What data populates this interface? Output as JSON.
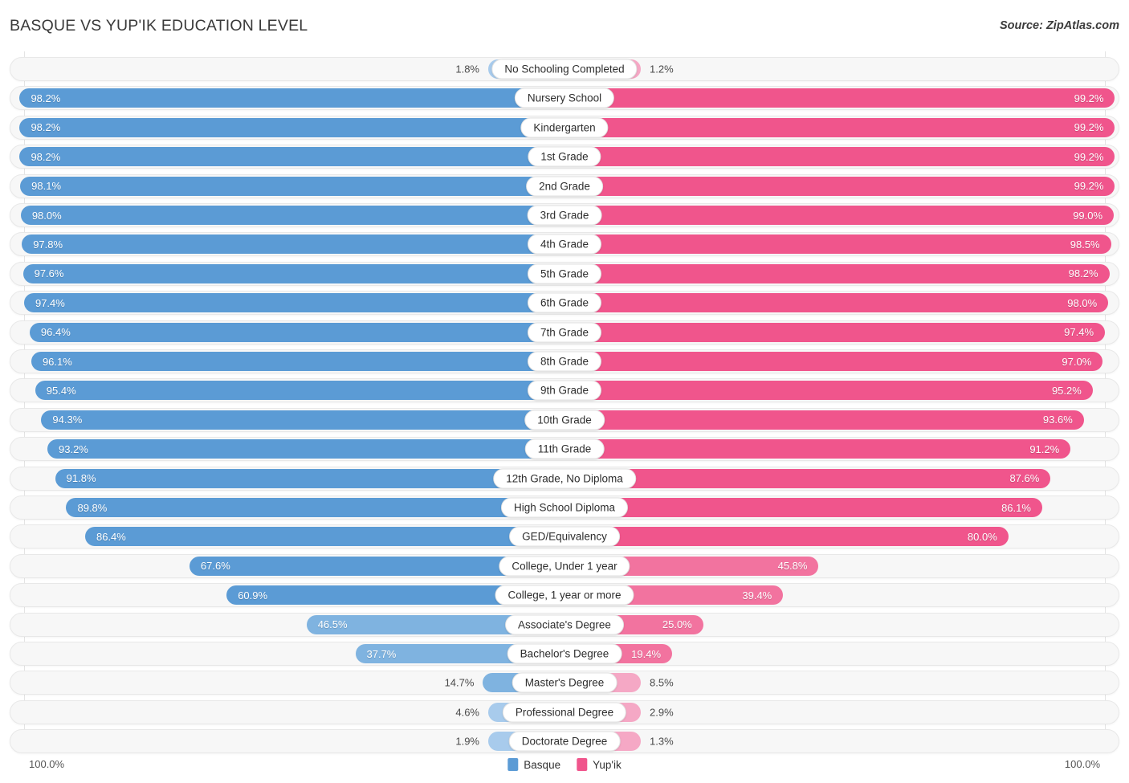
{
  "header": {
    "title": "BASQUE VS YUP'IK EDUCATION LEVEL",
    "source": "Source: ZipAtlas.com"
  },
  "legend": {
    "left_axis_max": "100.0%",
    "right_axis_max": "100.0%",
    "series": [
      {
        "name": "Basque",
        "color": "#5b9bd5"
      },
      {
        "name": "Yup'ik",
        "color": "#f0558c"
      }
    ]
  },
  "colors": {
    "basque_strong": "#5b9bd5",
    "basque_mid": "#7fb3e0",
    "basque_light": "#a8cbec",
    "yupik_strong": "#f0558c",
    "yupik_mid": "#f2739f",
    "yupik_light": "#f5a8c5",
    "track": "#f7f7f7",
    "track_border": "#e8e8e8"
  },
  "chart_data": {
    "type": "bar",
    "orientation": "diverging-horizontal",
    "title": "BASQUE VS YUP'IK EDUCATION LEVEL",
    "xlabel": "",
    "ylabel": "",
    "xlim": [
      0,
      100
    ],
    "grid": true,
    "legend_position": "bottom-center",
    "categories": [
      "No Schooling Completed",
      "Nursery School",
      "Kindergarten",
      "1st Grade",
      "2nd Grade",
      "3rd Grade",
      "4th Grade",
      "5th Grade",
      "6th Grade",
      "7th Grade",
      "8th Grade",
      "9th Grade",
      "10th Grade",
      "11th Grade",
      "12th Grade, No Diploma",
      "High School Diploma",
      "GED/Equivalency",
      "College, Under 1 year",
      "College, 1 year or more",
      "Associate's Degree",
      "Bachelor's Degree",
      "Master's Degree",
      "Professional Degree",
      "Doctorate Degree"
    ],
    "series": [
      {
        "name": "Basque",
        "side": "left",
        "color": "#5b9bd5",
        "values": [
          1.8,
          98.2,
          98.2,
          98.2,
          98.1,
          98.0,
          97.8,
          97.6,
          97.4,
          96.4,
          96.1,
          95.4,
          94.3,
          93.2,
          91.8,
          89.8,
          86.4,
          67.6,
          60.9,
          46.5,
          37.7,
          14.7,
          4.6,
          1.9
        ],
        "labels": [
          "1.8%",
          "98.2%",
          "98.2%",
          "98.2%",
          "98.1%",
          "98.0%",
          "97.8%",
          "97.6%",
          "97.4%",
          "96.4%",
          "96.1%",
          "95.4%",
          "94.3%",
          "93.2%",
          "91.8%",
          "89.8%",
          "86.4%",
          "67.6%",
          "60.9%",
          "46.5%",
          "37.7%",
          "14.7%",
          "4.6%",
          "1.9%"
        ]
      },
      {
        "name": "Yup'ik",
        "side": "right",
        "color": "#f0558c",
        "values": [
          1.2,
          99.2,
          99.2,
          99.2,
          99.2,
          99.0,
          98.5,
          98.2,
          98.0,
          97.4,
          97.0,
          95.2,
          93.6,
          91.2,
          87.6,
          86.1,
          80.0,
          45.8,
          39.4,
          25.0,
          19.4,
          8.5,
          2.9,
          1.3
        ],
        "labels": [
          "1.2%",
          "99.2%",
          "99.2%",
          "99.2%",
          "99.2%",
          "99.0%",
          "98.5%",
          "98.2%",
          "98.0%",
          "97.4%",
          "97.0%",
          "95.2%",
          "93.6%",
          "91.2%",
          "87.6%",
          "86.1%",
          "80.0%",
          "45.8%",
          "39.4%",
          "25.0%",
          "19.4%",
          "8.5%",
          "2.9%",
          "1.3%"
        ]
      }
    ]
  }
}
